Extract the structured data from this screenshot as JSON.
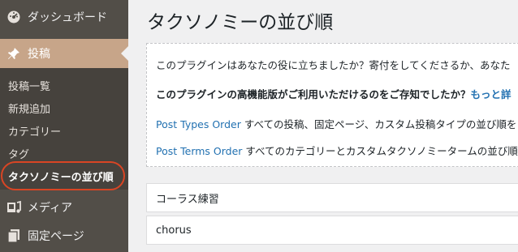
{
  "sidebar": {
    "dashboard": {
      "label": "ダッシュボード",
      "icon": "dashboard-icon"
    },
    "posts": {
      "label": "投稿",
      "icon": "pin-icon"
    },
    "posts_submenu": [
      {
        "label": "投稿一覧"
      },
      {
        "label": "新規追加"
      },
      {
        "label": "カテゴリー"
      },
      {
        "label": "タグ"
      },
      {
        "label": "タクソノミーの並び順",
        "current": true
      }
    ],
    "media": {
      "label": "メディア",
      "icon": "media-icon"
    },
    "pages": {
      "label": "固定ページ",
      "icon": "page-icon"
    },
    "accent_color": "#c7a589",
    "highlight_color": "#d94524"
  },
  "main": {
    "title": "タクソノミーの並び順",
    "notice": {
      "line1": "このプラグインはあなたの役に立ちましたか？寄付をしてくださるか、あなた",
      "line2_text": "このプラグインの高機能版がご利用いただけるのをご存知でしたか？",
      "line2_link": "もっと詳",
      "line3_link": "Post Types Order",
      "line3_text": " すべての投稿、固定ページ、カスタム投稿タイプの並び順を",
      "line4_link": "Post Terms Order",
      "line4_text": " すべてのカテゴリーとカスタムタクソノミータームの並び順"
    },
    "rows": [
      {
        "label": "コーラス練習"
      },
      {
        "label": "chorus"
      }
    ]
  }
}
